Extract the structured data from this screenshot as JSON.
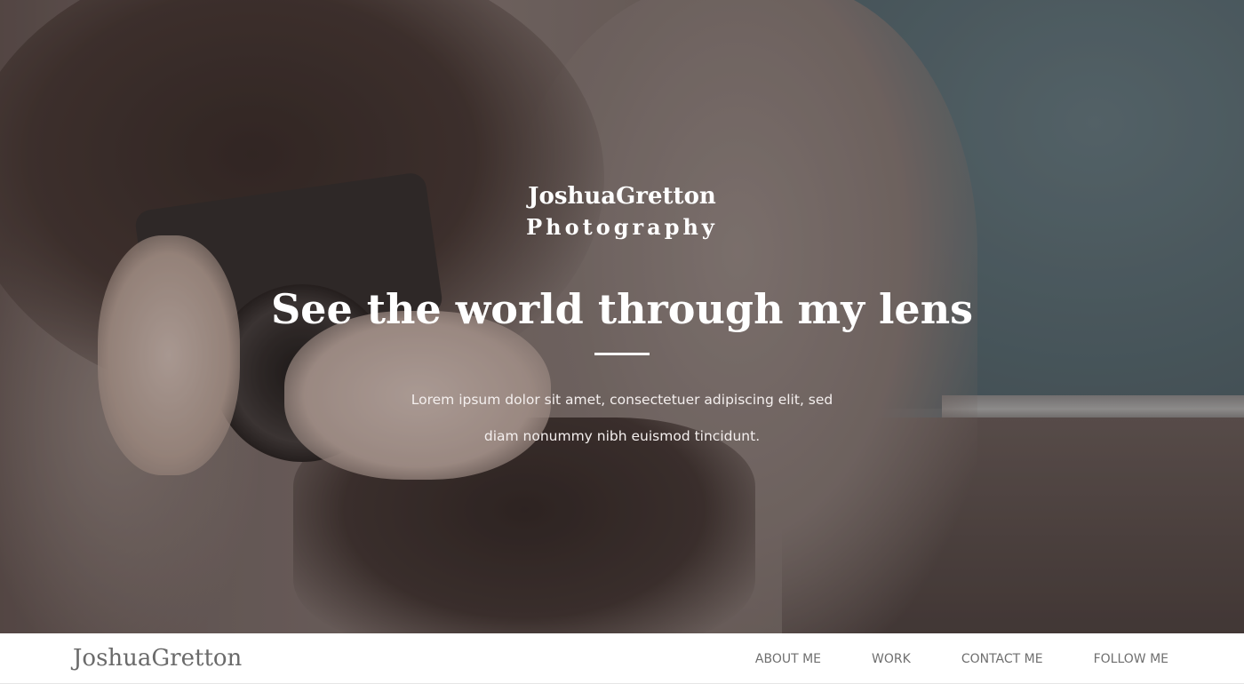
{
  "hero": {
    "brand_name": "JoshuaGretton",
    "brand_subtitle": "Photography",
    "headline": "See the world through my lens",
    "description": "Lorem ipsum dolor sit amet, consectetuer adipiscing elit, sed diam nonummy nibh euismod tincidunt.",
    "background_image": "photographer-holding-camera-photo"
  },
  "navbar": {
    "logo": "JoshuaGretton",
    "links": [
      {
        "label": "ABOUT ME"
      },
      {
        "label": "WORK"
      },
      {
        "label": "CONTACT ME"
      },
      {
        "label": "FOLLOW ME"
      }
    ]
  },
  "colors": {
    "hero_text": "#ffffff",
    "nav_background": "#ffffff",
    "nav_text": "#6f6f6f",
    "logo_text": "#6a6a6a"
  }
}
